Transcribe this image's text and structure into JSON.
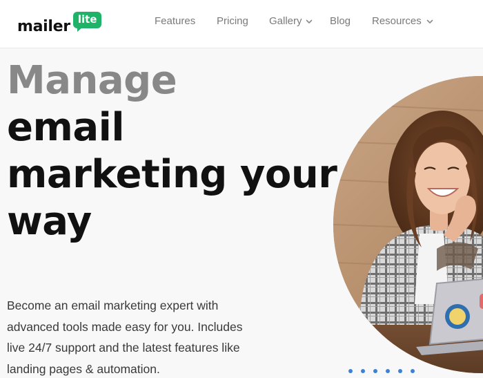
{
  "brand": {
    "name": "mailer",
    "badge": "lite",
    "badge_color": "#1fb36a"
  },
  "nav": {
    "items": [
      {
        "label": "Features",
        "has_dropdown": false
      },
      {
        "label": "Pricing",
        "has_dropdown": false
      },
      {
        "label": "Gallery",
        "has_dropdown": true
      },
      {
        "label": "Blog",
        "has_dropdown": false
      },
      {
        "label": "Resources",
        "has_dropdown": true
      }
    ]
  },
  "hero": {
    "headline_lines": [
      "Manage",
      "email",
      "marketing your",
      "way"
    ],
    "subtext_lines": [
      "Become an email marketing expert with",
      "advanced tools made easy for you. Includes",
      "live 24/7 support and the latest features like",
      "landing pages & automation."
    ],
    "image": "woman-smiling-at-laptop-photo",
    "carousel_dot_count": 6,
    "carousel_dot_color": "#3b82d6"
  }
}
